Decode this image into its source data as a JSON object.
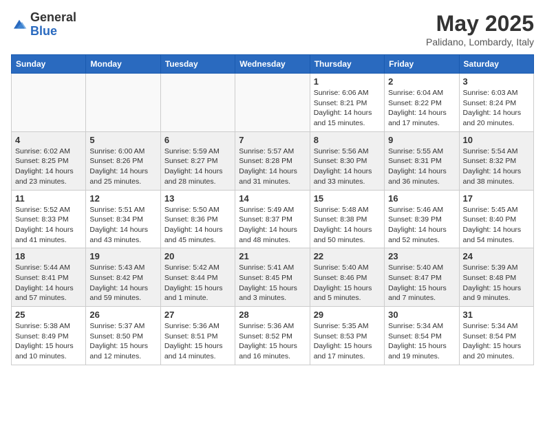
{
  "logo": {
    "general": "General",
    "blue": "Blue"
  },
  "title": "May 2025",
  "subtitle": "Palidano, Lombardy, Italy",
  "days": [
    "Sunday",
    "Monday",
    "Tuesday",
    "Wednesday",
    "Thursday",
    "Friday",
    "Saturday"
  ],
  "weeks": [
    [
      {
        "day": "",
        "content": ""
      },
      {
        "day": "",
        "content": ""
      },
      {
        "day": "",
        "content": ""
      },
      {
        "day": "",
        "content": ""
      },
      {
        "day": "1",
        "content": "Sunrise: 6:06 AM\nSunset: 8:21 PM\nDaylight: 14 hours and 15 minutes."
      },
      {
        "day": "2",
        "content": "Sunrise: 6:04 AM\nSunset: 8:22 PM\nDaylight: 14 hours and 17 minutes."
      },
      {
        "day": "3",
        "content": "Sunrise: 6:03 AM\nSunset: 8:24 PM\nDaylight: 14 hours and 20 minutes."
      }
    ],
    [
      {
        "day": "4",
        "content": "Sunrise: 6:02 AM\nSunset: 8:25 PM\nDaylight: 14 hours and 23 minutes."
      },
      {
        "day": "5",
        "content": "Sunrise: 6:00 AM\nSunset: 8:26 PM\nDaylight: 14 hours and 25 minutes."
      },
      {
        "day": "6",
        "content": "Sunrise: 5:59 AM\nSunset: 8:27 PM\nDaylight: 14 hours and 28 minutes."
      },
      {
        "day": "7",
        "content": "Sunrise: 5:57 AM\nSunset: 8:28 PM\nDaylight: 14 hours and 31 minutes."
      },
      {
        "day": "8",
        "content": "Sunrise: 5:56 AM\nSunset: 8:30 PM\nDaylight: 14 hours and 33 minutes."
      },
      {
        "day": "9",
        "content": "Sunrise: 5:55 AM\nSunset: 8:31 PM\nDaylight: 14 hours and 36 minutes."
      },
      {
        "day": "10",
        "content": "Sunrise: 5:54 AM\nSunset: 8:32 PM\nDaylight: 14 hours and 38 minutes."
      }
    ],
    [
      {
        "day": "11",
        "content": "Sunrise: 5:52 AM\nSunset: 8:33 PM\nDaylight: 14 hours and 41 minutes."
      },
      {
        "day": "12",
        "content": "Sunrise: 5:51 AM\nSunset: 8:34 PM\nDaylight: 14 hours and 43 minutes."
      },
      {
        "day": "13",
        "content": "Sunrise: 5:50 AM\nSunset: 8:36 PM\nDaylight: 14 hours and 45 minutes."
      },
      {
        "day": "14",
        "content": "Sunrise: 5:49 AM\nSunset: 8:37 PM\nDaylight: 14 hours and 48 minutes."
      },
      {
        "day": "15",
        "content": "Sunrise: 5:48 AM\nSunset: 8:38 PM\nDaylight: 14 hours and 50 minutes."
      },
      {
        "day": "16",
        "content": "Sunrise: 5:46 AM\nSunset: 8:39 PM\nDaylight: 14 hours and 52 minutes."
      },
      {
        "day": "17",
        "content": "Sunrise: 5:45 AM\nSunset: 8:40 PM\nDaylight: 14 hours and 54 minutes."
      }
    ],
    [
      {
        "day": "18",
        "content": "Sunrise: 5:44 AM\nSunset: 8:41 PM\nDaylight: 14 hours and 57 minutes."
      },
      {
        "day": "19",
        "content": "Sunrise: 5:43 AM\nSunset: 8:42 PM\nDaylight: 14 hours and 59 minutes."
      },
      {
        "day": "20",
        "content": "Sunrise: 5:42 AM\nSunset: 8:44 PM\nDaylight: 15 hours and 1 minute."
      },
      {
        "day": "21",
        "content": "Sunrise: 5:41 AM\nSunset: 8:45 PM\nDaylight: 15 hours and 3 minutes."
      },
      {
        "day": "22",
        "content": "Sunrise: 5:40 AM\nSunset: 8:46 PM\nDaylight: 15 hours and 5 minutes."
      },
      {
        "day": "23",
        "content": "Sunrise: 5:40 AM\nSunset: 8:47 PM\nDaylight: 15 hours and 7 minutes."
      },
      {
        "day": "24",
        "content": "Sunrise: 5:39 AM\nSunset: 8:48 PM\nDaylight: 15 hours and 9 minutes."
      }
    ],
    [
      {
        "day": "25",
        "content": "Sunrise: 5:38 AM\nSunset: 8:49 PM\nDaylight: 15 hours and 10 minutes."
      },
      {
        "day": "26",
        "content": "Sunrise: 5:37 AM\nSunset: 8:50 PM\nDaylight: 15 hours and 12 minutes."
      },
      {
        "day": "27",
        "content": "Sunrise: 5:36 AM\nSunset: 8:51 PM\nDaylight: 15 hours and 14 minutes."
      },
      {
        "day": "28",
        "content": "Sunrise: 5:36 AM\nSunset: 8:52 PM\nDaylight: 15 hours and 16 minutes."
      },
      {
        "day": "29",
        "content": "Sunrise: 5:35 AM\nSunset: 8:53 PM\nDaylight: 15 hours and 17 minutes."
      },
      {
        "day": "30",
        "content": "Sunrise: 5:34 AM\nSunset: 8:54 PM\nDaylight: 15 hours and 19 minutes."
      },
      {
        "day": "31",
        "content": "Sunrise: 5:34 AM\nSunset: 8:54 PM\nDaylight: 15 hours and 20 minutes."
      }
    ]
  ]
}
